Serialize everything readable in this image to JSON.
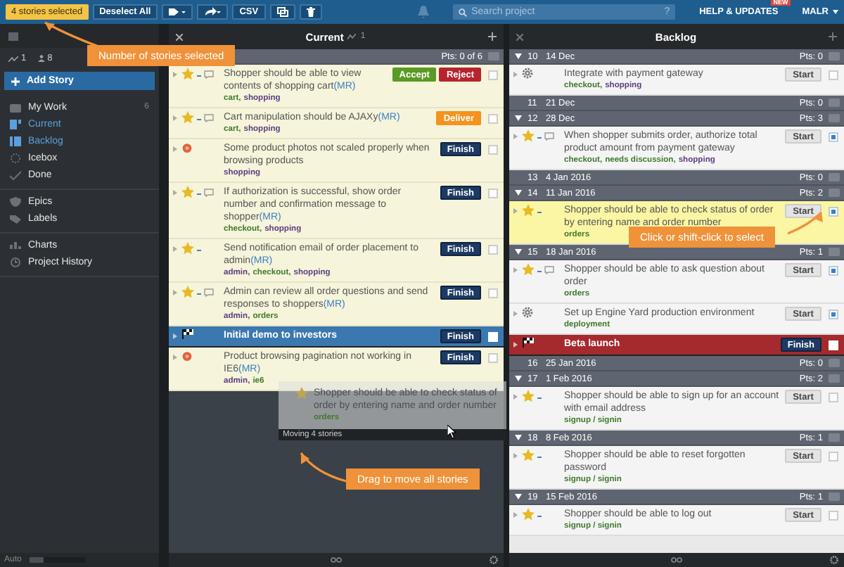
{
  "topbar": {
    "selection": "4 stories selected",
    "deselect": "Deselect All",
    "export": "CSV",
    "search": {
      "placeholder": "Search project",
      "help": "?"
    },
    "help": "HELP & UPDATES",
    "badge": "NEW",
    "user": "MALR"
  },
  "sidebar": {
    "stats": [
      "1",
      "8"
    ],
    "add": "Add Story",
    "sections": [
      [
        {
          "label": "My Work",
          "count": "6",
          "selected": false
        },
        {
          "label": "Current",
          "selected": true
        },
        {
          "label": "Backlog",
          "selected": true
        },
        {
          "label": "Icebox",
          "selected": false
        },
        {
          "label": "Done",
          "selected": false
        }
      ],
      [
        {
          "label": "Epics",
          "selected": false
        },
        {
          "label": "Labels",
          "selected": false
        }
      ],
      [
        {
          "label": "Charts",
          "selected": false
        },
        {
          "label": "Project History",
          "selected": false
        }
      ]
    ],
    "footer": "Auto",
    "zoom": {
      "level": 0.25
    }
  },
  "current": {
    "title": "Current",
    "velocity": "1",
    "points": "Pts: 0 of 6",
    "stories": [
      {
        "kind": "feature",
        "title": "Shopper should be able to view contents of shopping cart",
        "link": "(MR)",
        "comment": true,
        "labels": [
          {
            "text": "cart,",
            "color": "#3d7a2b"
          },
          {
            "text": "shopping",
            "color": "#5b3d80"
          }
        ],
        "actions": [
          {
            "label": "Accept",
            "kind": "accept"
          },
          {
            "label": "Reject",
            "kind": "reject"
          }
        ],
        "checked": false
      },
      {
        "kind": "feature",
        "title": "Cart manipulation should be AJAXy",
        "link": "(MR)",
        "comment": true,
        "labels": [
          {
            "text": "cart,",
            "color": "#3d7a2b"
          },
          {
            "text": "shopping",
            "color": "#5b3d80"
          }
        ],
        "actions": [
          {
            "label": "Deliver",
            "kind": "deliver"
          }
        ],
        "checked": false
      },
      {
        "kind": "bug",
        "title": "Some product photos not scaled properly when browsing products",
        "comment": false,
        "labels": [
          {
            "text": "shopping",
            "color": "#5b3d80"
          }
        ],
        "actions": [
          {
            "label": "Finish",
            "kind": "finish"
          }
        ],
        "checked": false
      },
      {
        "kind": "feature",
        "title": "If authorization is successful, show order number and confirmation message to shopper",
        "link": "(MR)",
        "comment": true,
        "labels": [
          {
            "text": "checkout,",
            "color": "#3d7a2b"
          },
          {
            "text": "shopping",
            "color": "#5b3d80"
          }
        ],
        "actions": [
          {
            "label": "Finish",
            "kind": "finish"
          }
        ],
        "checked": false
      },
      {
        "kind": "feature",
        "title": "Send notification email of order placement to admin",
        "link": "(MR)",
        "comment": false,
        "labels": [
          {
            "text": "admin,",
            "color": "#5b3d80"
          },
          {
            "text": "checkout,",
            "color": "#3d7a2b"
          },
          {
            "text": "shopping",
            "color": "#5b3d80"
          }
        ],
        "actions": [
          {
            "label": "Finish",
            "kind": "finish"
          }
        ],
        "checked": false
      },
      {
        "kind": "feature",
        "title": "Admin can review all order questions and send responses to shoppers",
        "link": "(MR)",
        "comment": true,
        "labels": [
          {
            "text": "admin,",
            "color": "#5b3d80"
          },
          {
            "text": "orders",
            "color": "#3d7a2b"
          }
        ],
        "actions": [
          {
            "label": "Finish",
            "kind": "finish"
          }
        ],
        "checked": false
      },
      {
        "kind": "release",
        "title": "Initial demo to investors",
        "color": "#3b78b0",
        "comment": false,
        "actions": [
          {
            "label": "Finish",
            "kind": "finish"
          }
        ],
        "checked": false
      },
      {
        "kind": "bug",
        "title": "Product browsing pagination not working in IE6",
        "link": "(MR)",
        "comment": false,
        "labels": [
          {
            "text": "admin,",
            "color": "#5b3d80"
          },
          {
            "text": "ie6",
            "color": "#3d7a2b"
          }
        ],
        "actions": [
          {
            "label": "Finish",
            "kind": "finish"
          }
        ],
        "checked": false
      }
    ]
  },
  "backlog": {
    "title": "Backlog",
    "iterations": [
      {
        "number": "10",
        "date": "14 Dec",
        "points": "Pts: 0",
        "expanded": true,
        "stories": [
          {
            "kind": "chore",
            "title": "Integrate with payment gateway",
            "comment": false,
            "labels": [
              {
                "text": "checkout,",
                "color": "#3d7a2b"
              },
              {
                "text": "shopping",
                "color": "#5b3d80"
              }
            ],
            "actions": [
              {
                "label": "Start",
                "kind": "start"
              }
            ],
            "checked": false,
            "highlighted": false
          }
        ]
      },
      {
        "number": "11",
        "date": "21 Dec",
        "points": "Pts: 0",
        "expanded": false
      },
      {
        "number": "12",
        "date": "28 Dec",
        "points": "Pts: 3",
        "expanded": true,
        "stories": [
          {
            "kind": "feature",
            "title": "When shopper submits order, authorize total product amount from payment gateway",
            "comment": true,
            "labels": [
              {
                "text": "checkout,",
                "color": "#3d7a2b"
              },
              {
                "text": "needs discussion,",
                "color": "#3d7a2b"
              },
              {
                "text": "shopping",
                "color": "#5b3d80"
              }
            ],
            "actions": [
              {
                "label": "Start",
                "kind": "start"
              }
            ],
            "checked": true,
            "highlighted": false
          }
        ]
      },
      {
        "number": "13",
        "date": "4 Jan 2016",
        "points": "Pts: 0",
        "expanded": false
      },
      {
        "number": "14",
        "date": "11 Jan 2016",
        "points": "Pts: 2",
        "expanded": true,
        "stories": [
          {
            "kind": "feature",
            "title": "Shopper should be able to check status of order by entering name and order number",
            "comment": false,
            "labels": [
              {
                "text": "orders",
                "color": "#3d7a2b"
              }
            ],
            "actions": [
              {
                "label": "Start",
                "kind": "start"
              }
            ],
            "checked": true,
            "highlighted": true
          }
        ]
      },
      {
        "number": "15",
        "date": "18 Jan 2016",
        "points": "Pts: 1",
        "expanded": true,
        "stories": [
          {
            "kind": "feature",
            "title": "Shopper should be able to ask question about order",
            "comment": true,
            "labels": [
              {
                "text": "orders",
                "color": "#3d7a2b"
              }
            ],
            "actions": [
              {
                "label": "Start",
                "kind": "start"
              }
            ],
            "checked": true,
            "highlighted": false
          },
          {
            "kind": "chore",
            "title": "Set up Engine Yard production environment",
            "comment": false,
            "labels": [
              {
                "text": "deployment",
                "color": "#3d7a2b"
              }
            ],
            "actions": [
              {
                "label": "Start",
                "kind": "start"
              }
            ],
            "checked": true,
            "highlighted": false
          },
          {
            "kind": "release",
            "title": "Beta launch",
            "color": "#a52a2d",
            "comment": false,
            "actions": [
              {
                "label": "Finish",
                "kind": "finish"
              }
            ],
            "checked": false
          }
        ]
      },
      {
        "number": "16",
        "date": "25 Jan 2016",
        "points": "Pts: 0",
        "expanded": false
      },
      {
        "number": "17",
        "date": "1 Feb 2016",
        "points": "Pts: 2",
        "expanded": true,
        "stories": [
          {
            "kind": "feature",
            "title": "Shopper should be able to sign up for an account with email address",
            "comment": false,
            "labels": [
              {
                "text": "signup / signin",
                "color": "#3d7a2b"
              }
            ],
            "actions": [
              {
                "label": "Start",
                "kind": "start"
              }
            ],
            "checked": false,
            "highlighted": false
          }
        ]
      },
      {
        "number": "18",
        "date": "8 Feb 2016",
        "points": "Pts: 1",
        "expanded": true,
        "stories": [
          {
            "kind": "feature",
            "title": "Shopper should be able to reset forgotten password",
            "comment": false,
            "labels": [
              {
                "text": "signup / signin",
                "color": "#3d7a2b"
              }
            ],
            "actions": [
              {
                "label": "Start",
                "kind": "start"
              }
            ],
            "checked": false,
            "highlighted": false
          }
        ]
      },
      {
        "number": "19",
        "date": "15 Feb 2016",
        "points": "Pts: 1",
        "expanded": true,
        "stories": [
          {
            "kind": "feature",
            "title": "Shopper should be able to log out",
            "comment": false,
            "labels": [
              {
                "text": "signup / signin",
                "color": "#3d7a2b"
              }
            ],
            "actions": [
              {
                "label": "Start",
                "kind": "start"
              }
            ],
            "checked": false,
            "highlighted": false
          }
        ]
      }
    ]
  },
  "drag_preview": {
    "title": "Shopper should be able to check status of order by entering name and order number",
    "labels": [
      {
        "text": "orders",
        "color": "#3d7a2b"
      }
    ],
    "footer": "Moving 4 stories"
  },
  "callouts": [
    {
      "kind": "selection",
      "text": "Number of stories selected"
    },
    {
      "kind": "checkbox",
      "text": "Click or shift-click to select"
    },
    {
      "kind": "drag",
      "text": "Drag to move all stories"
    }
  ]
}
